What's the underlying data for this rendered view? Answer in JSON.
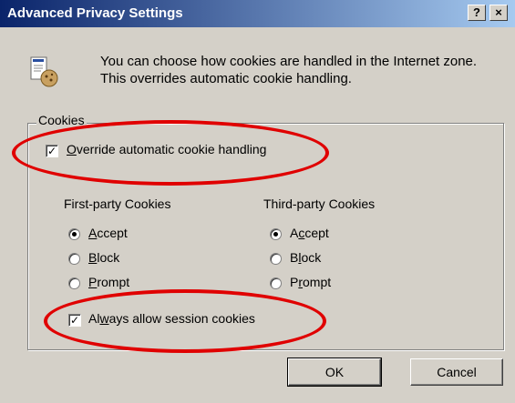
{
  "window": {
    "title": "Advanced Privacy Settings",
    "help_btn": "?",
    "close_btn": "×"
  },
  "intro": {
    "icon": "privacy-icon",
    "text": "You can choose how cookies are handled in the Internet zone.  This overrides automatic cookie handling."
  },
  "cookies": {
    "group_label": "Cookies",
    "override": {
      "prefix": "",
      "accel": "O",
      "rest": "verride automatic cookie handling",
      "checked": true
    },
    "first_party": {
      "header": "First-party Cookies",
      "options": [
        {
          "accel": "A",
          "rest": "ccept",
          "selected": true
        },
        {
          "accel": "B",
          "rest": "lock",
          "selected": false
        },
        {
          "accel": "P",
          "rest": "rompt",
          "selected": false
        }
      ]
    },
    "third_party": {
      "header": "Third-party Cookies",
      "options": [
        {
          "prefix": "A",
          "accel": "c",
          "rest": "cept",
          "selected": true
        },
        {
          "prefix": "B",
          "accel": "l",
          "rest": "ock",
          "selected": false
        },
        {
          "prefix": "P",
          "accel": "r",
          "rest": "ompt",
          "selected": false
        }
      ]
    },
    "session": {
      "prefix": "Al",
      "accel": "w",
      "rest": "ays allow session cookies",
      "checked": true
    }
  },
  "buttons": {
    "ok": "OK",
    "cancel": "Cancel"
  },
  "colors": {
    "highlight_ellipse": "#e00000",
    "titlebar": "#0a246a"
  }
}
